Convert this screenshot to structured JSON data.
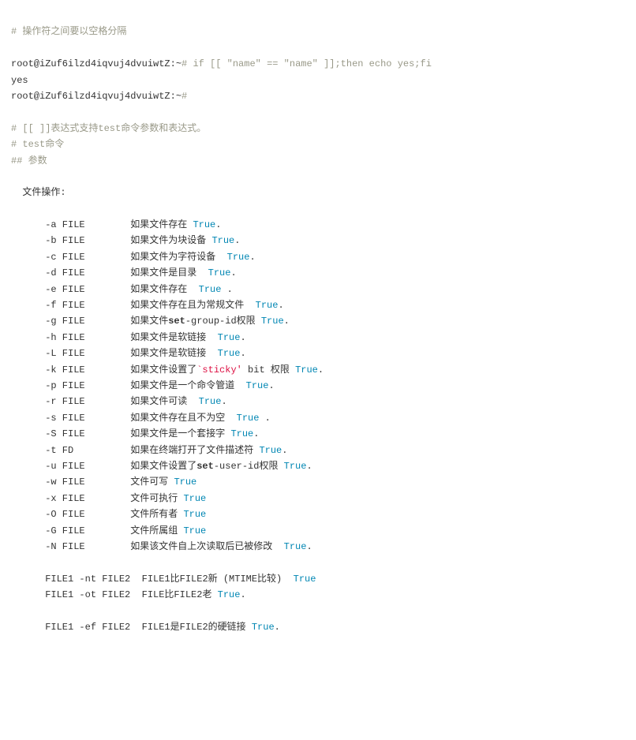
{
  "lines": [
    [
      {
        "t": "# 操作符之间要以空格分隔",
        "c": "c-comment"
      }
    ],
    [],
    [
      {
        "t": "root@iZuf6ilzd4iqvuj4dvuiwtZ:~"
      },
      {
        "t": "# if [[ \"name\" == \"name\" ]];then echo yes;fi",
        "c": "c-comment"
      }
    ],
    [
      {
        "t": "yes"
      }
    ],
    [
      {
        "t": "root@iZuf6ilzd4iqvuj4dvuiwtZ:~"
      },
      {
        "t": "#",
        "c": "c-comment"
      }
    ],
    [],
    [
      {
        "t": "# [[ ]]表达式支持test命令参数和表达式。",
        "c": "c-comment"
      }
    ],
    [
      {
        "t": "# test命令",
        "c": "c-comment"
      }
    ],
    [
      {
        "t": "## 参数",
        "c": "c-comment"
      }
    ],
    [],
    [
      {
        "t": "  文件操作:"
      }
    ],
    [],
    [
      {
        "t": "      -a FILE        如果文件存在 "
      },
      {
        "t": "True",
        "c": "c-builtin"
      },
      {
        "t": "."
      }
    ],
    [
      {
        "t": "      -b FILE        如果文件为块设备 "
      },
      {
        "t": "True",
        "c": "c-builtin"
      },
      {
        "t": "."
      }
    ],
    [
      {
        "t": "      -c FILE        如果文件为字符设备  "
      },
      {
        "t": "True",
        "c": "c-builtin"
      },
      {
        "t": "."
      }
    ],
    [
      {
        "t": "      -d FILE        如果文件是目录  "
      },
      {
        "t": "True",
        "c": "c-builtin"
      },
      {
        "t": "."
      }
    ],
    [
      {
        "t": "      -e FILE        如果文件存在  "
      },
      {
        "t": "True",
        "c": "c-builtin"
      },
      {
        "t": " ."
      }
    ],
    [
      {
        "t": "      -f FILE        如果文件存在且为常规文件  "
      },
      {
        "t": "True",
        "c": "c-builtin"
      },
      {
        "t": "."
      }
    ],
    [
      {
        "t": "      -g FILE        如果文件"
      },
      {
        "t": "set",
        "c": "c-kw"
      },
      {
        "t": "-group-id权限 "
      },
      {
        "t": "True",
        "c": "c-builtin"
      },
      {
        "t": "."
      }
    ],
    [
      {
        "t": "      -h FILE        如果文件是软链接  "
      },
      {
        "t": "True",
        "c": "c-builtin"
      },
      {
        "t": "."
      }
    ],
    [
      {
        "t": "      -L FILE        如果文件是软链接  "
      },
      {
        "t": "True",
        "c": "c-builtin"
      },
      {
        "t": "."
      }
    ],
    [
      {
        "t": "      -k FILE        如果文件设置了"
      },
      {
        "t": "`sticky'",
        "c": "c-string"
      },
      {
        "t": " bit 权限 "
      },
      {
        "t": "True",
        "c": "c-builtin"
      },
      {
        "t": "."
      }
    ],
    [
      {
        "t": "      -p FILE        如果文件是一个命令管道  "
      },
      {
        "t": "True",
        "c": "c-builtin"
      },
      {
        "t": "."
      }
    ],
    [
      {
        "t": "      -r FILE        如果文件可读  "
      },
      {
        "t": "True",
        "c": "c-builtin"
      },
      {
        "t": "."
      }
    ],
    [
      {
        "t": "      -s FILE        如果文件存在且不为空  "
      },
      {
        "t": "True",
        "c": "c-builtin"
      },
      {
        "t": " ."
      }
    ],
    [
      {
        "t": "      -S FILE        如果文件是一个套接字 "
      },
      {
        "t": "True",
        "c": "c-builtin"
      },
      {
        "t": "."
      }
    ],
    [
      {
        "t": "      -t FD          如果在终端打开了文件描述符 "
      },
      {
        "t": "True",
        "c": "c-builtin"
      },
      {
        "t": "."
      }
    ],
    [
      {
        "t": "      -u FILE        如果文件设置了"
      },
      {
        "t": "set",
        "c": "c-kw"
      },
      {
        "t": "-user-id权限 "
      },
      {
        "t": "True",
        "c": "c-builtin"
      },
      {
        "t": "."
      }
    ],
    [
      {
        "t": "      -w FILE        文件可写 "
      },
      {
        "t": "True",
        "c": "c-builtin"
      }
    ],
    [
      {
        "t": "      -x FILE        文件可执行 "
      },
      {
        "t": "True",
        "c": "c-builtin"
      }
    ],
    [
      {
        "t": "      -O FILE        文件所有者 "
      },
      {
        "t": "True",
        "c": "c-builtin"
      }
    ],
    [
      {
        "t": "      -G FILE        文件所属组 "
      },
      {
        "t": "True",
        "c": "c-builtin"
      }
    ],
    [
      {
        "t": "      -N FILE        如果该文件自上次读取后已被修改  "
      },
      {
        "t": "True",
        "c": "c-builtin"
      },
      {
        "t": "."
      }
    ],
    [],
    [
      {
        "t": "      FILE1 -nt FILE2  FILE1比FILE2新 (MTIME比较)  "
      },
      {
        "t": "True",
        "c": "c-builtin"
      }
    ],
    [
      {
        "t": "      FILE1 -ot FILE2  FILE比FILE2老 "
      },
      {
        "t": "True",
        "c": "c-builtin"
      },
      {
        "t": "."
      }
    ],
    [],
    [
      {
        "t": "      FILE1 -ef FILE2  FILE1是FILE2的硬链接 "
      },
      {
        "t": "True",
        "c": "c-builtin"
      },
      {
        "t": "."
      }
    ]
  ]
}
